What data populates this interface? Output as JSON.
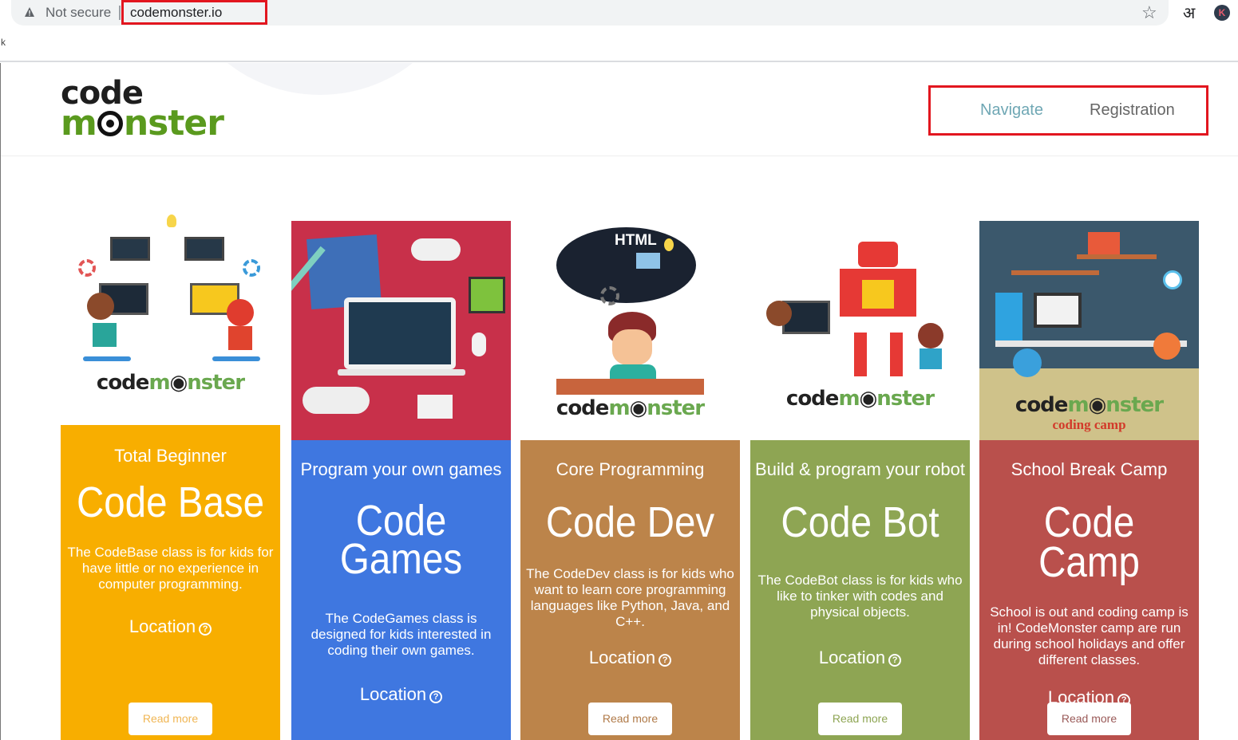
{
  "browser": {
    "security_label": "Not secure",
    "url": "codemonster.io",
    "bookmark_fragment": "k",
    "lang_icon_glyph": "अ",
    "profile_initial": "K",
    "icons": [
      "warning-icon",
      "star-icon",
      "translate-icon",
      "profile-avatar"
    ]
  },
  "header": {
    "logo_top": "code",
    "logo_bottom_left": "m",
    "logo_bottom_right": "nster",
    "nav": [
      {
        "label": "Navigate",
        "color": "#6fa7b4"
      },
      {
        "label": "Registration",
        "color": "#666666"
      }
    ],
    "highlight_color": "#e2161f"
  },
  "cards": [
    {
      "subtitle": "Total Beginner",
      "title": "Code Base",
      "description": "The CodeBase class is for kids for have little or no experience in computer programming.",
      "location_label": "Location",
      "button_label": "Read more",
      "color": "#f8ae00",
      "watermark_left": "code",
      "watermark_mid": "m",
      "watermark_right": "nster"
    },
    {
      "subtitle": "Program your own games",
      "title_line1": "Code",
      "title_line2": "Games",
      "description": "The CodeGames class is designed for kids interested in coding their own games.",
      "location_label": "Location",
      "color": "#3f77e0",
      "image_bg": "#c8304a"
    },
    {
      "subtitle": "Core Programming",
      "title": "Code Dev",
      "description": "The CodeDev class is for kids who want to learn core programming languages like Python, Java, and C++.",
      "location_label": "Location",
      "button_label": "Read more",
      "color": "#bc844a",
      "bubble_text": "HTML",
      "watermark_left": "code",
      "watermark_mid": "m",
      "watermark_right": "nster"
    },
    {
      "subtitle": "Build & program your robot",
      "title": "Code Bot",
      "description": "The CodeBot class is for kids who like to tinker with codes and physical objects.",
      "location_label": "Location",
      "button_label": "Read more",
      "color": "#8ea553",
      "watermark_left": "code",
      "watermark_mid": "m",
      "watermark_right": "nster"
    },
    {
      "subtitle": "School Break Camp",
      "title": "Code Camp",
      "description": "School is out and coding camp is in! CodeMonster camp are run during school holidays and offer different classes.",
      "location_label": "Location",
      "button_label": "Read more",
      "color": "#b9504c",
      "image_bg": "#3b586c",
      "watermark_left": "code",
      "watermark_mid": "m",
      "watermark_right": "nster",
      "watermark_sub": "coding camp"
    }
  ],
  "help_glyph": "?"
}
